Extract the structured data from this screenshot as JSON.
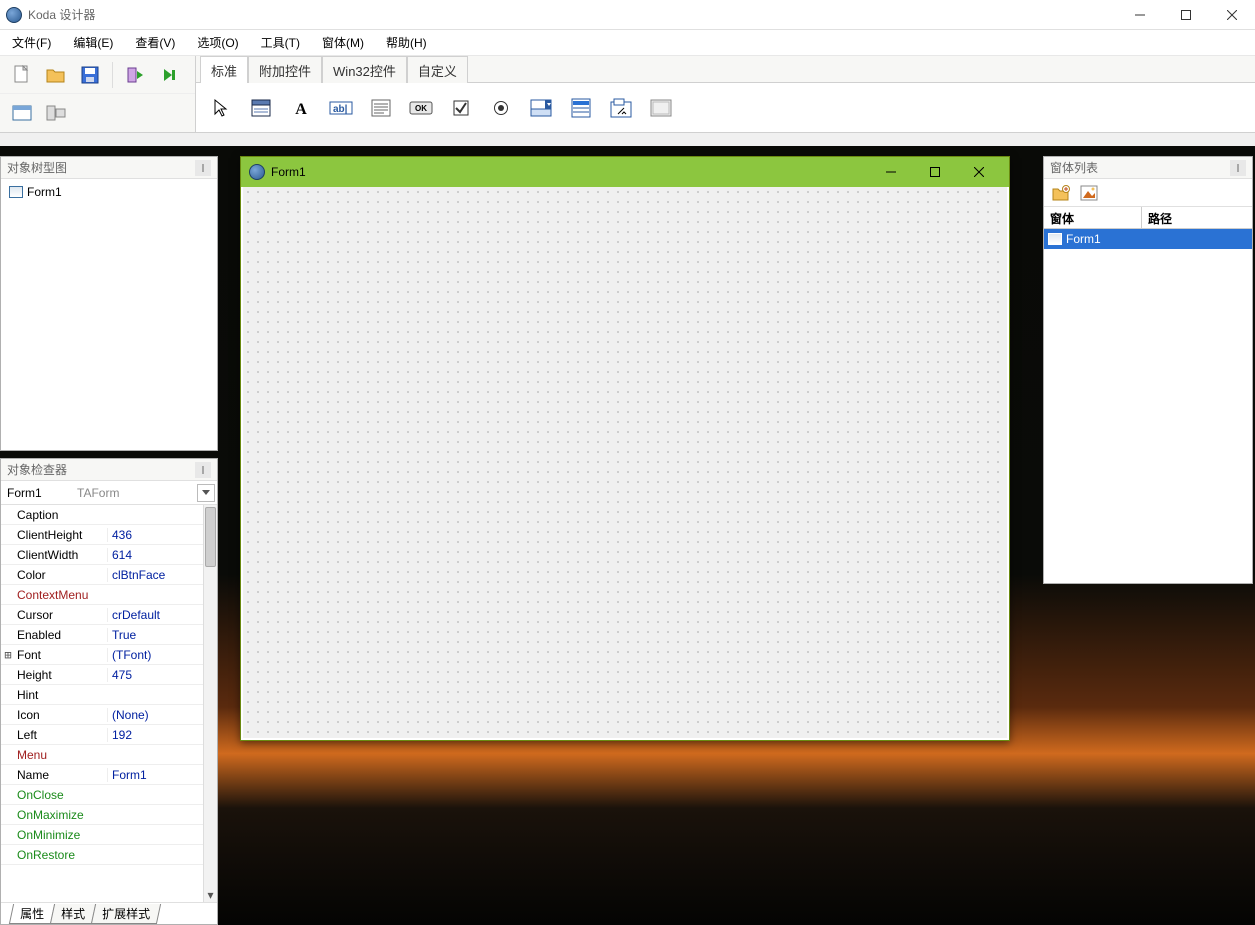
{
  "app": {
    "title": "Koda 设计器"
  },
  "menubar": [
    "文件(F)",
    "编辑(E)",
    "查看(V)",
    "选项(O)",
    "工具(T)",
    "窗体(M)",
    "帮助(H)"
  ],
  "component_tabs": [
    "标准",
    "附加控件",
    "Win32控件",
    "自定义"
  ],
  "tree_panel": {
    "title": "对象树型图",
    "root": "Form1"
  },
  "inspector": {
    "title": "对象检查器",
    "object_name": "Form1",
    "object_type": "TAForm",
    "tabs": [
      "属性",
      "样式",
      "扩展样式"
    ],
    "properties": [
      {
        "k": "Caption",
        "v": "",
        "cls": ""
      },
      {
        "k": "ClientHeight",
        "v": "436",
        "cls": ""
      },
      {
        "k": "ClientWidth",
        "v": "614",
        "cls": ""
      },
      {
        "k": "Color",
        "v": "clBtnFace",
        "cls": ""
      },
      {
        "k": "ContextMenu",
        "v": "",
        "cls": "k-red"
      },
      {
        "k": "Cursor",
        "v": "crDefault",
        "cls": ""
      },
      {
        "k": "Enabled",
        "v": "True",
        "cls": ""
      },
      {
        "k": "Font",
        "v": "(TFont)",
        "cls": "",
        "exp": "⊞"
      },
      {
        "k": "Height",
        "v": "475",
        "cls": ""
      },
      {
        "k": "Hint",
        "v": "",
        "cls": ""
      },
      {
        "k": "Icon",
        "v": "(None)",
        "cls": ""
      },
      {
        "k": "Left",
        "v": "192",
        "cls": ""
      },
      {
        "k": "Menu",
        "v": "",
        "cls": "k-red"
      },
      {
        "k": "Name",
        "v": "Form1",
        "cls": ""
      },
      {
        "k": "OnClose",
        "v": "",
        "cls": "k-green"
      },
      {
        "k": "OnMaximize",
        "v": "",
        "cls": "k-green"
      },
      {
        "k": "OnMinimize",
        "v": "",
        "cls": "k-green"
      },
      {
        "k": "OnRestore",
        "v": "",
        "cls": "k-green"
      }
    ]
  },
  "forms_panel": {
    "title": "窗体列表",
    "columns": [
      "窗体",
      "路径"
    ],
    "rows": [
      {
        "name": "Form1",
        "path": ""
      }
    ]
  },
  "design_form": {
    "caption": "Form1"
  }
}
